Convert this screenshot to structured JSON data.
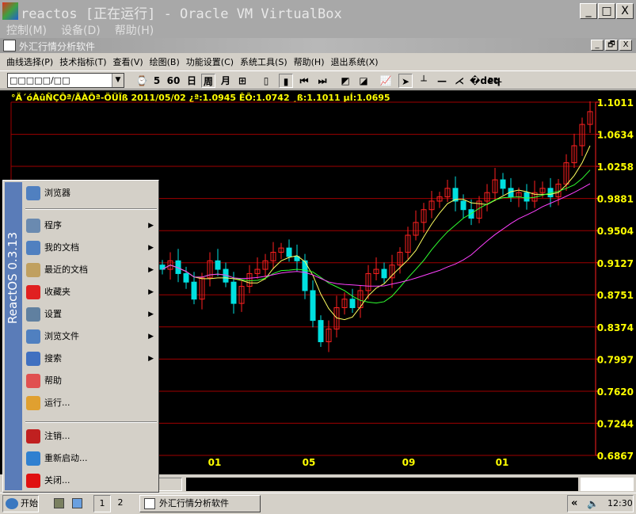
{
  "vbox": {
    "title": "reactos [正在运行] - Oracle VM VirtualBox",
    "menu": [
      "控制(M)",
      "设备(D)",
      "帮助(H)"
    ],
    "controls": [
      "_",
      "□",
      "X"
    ]
  },
  "app": {
    "title": "外汇行情分析软件",
    "controls": [
      "_",
      "🗗",
      "X"
    ],
    "menu": [
      "曲线选择(P)",
      "技术指标(T)",
      "查看(V)",
      "绘图(B)",
      "功能设置(C)",
      "系统工具(S)",
      "帮助(H)",
      "退出系统(X)"
    ],
    "toolbar": {
      "combo_value": "□□□□□/□□",
      "buttons": [
        "⌚",
        "5",
        "60",
        "日",
        "周",
        "月",
        "⊞",
        "▯",
        "▮",
        "⏮",
        "⏭",
        "◩",
        "◪",
        "📈",
        "➤",
        "┴",
        "—",
        "⋌",
        "�deq",
        "DEL"
      ]
    }
  },
  "chart_data": {
    "type": "candlestick",
    "header": "°Ä´óÀûÑÇÔª/ÃÀÔª-ÖÜÏß 2011/05/02 ¿ª:1.0945 ÊÕ:1.0742 ¸ß:1.1011 µÍ:1.0695",
    "ylim": [
      0.6867,
      1.1011
    ],
    "y_ticks": [
      "1.1011",
      "1.0634",
      "1.0258",
      "0.9881",
      "0.9504",
      "0.9127",
      "0.8751",
      "0.8374",
      "0.7997",
      "0.7620",
      "0.7244",
      "0.6867"
    ],
    "x_ticks": [
      "01",
      "05",
      "09",
      "01"
    ],
    "grid": true,
    "closes": [
      0.905,
      0.915,
      0.9,
      0.89,
      0.87,
      0.895,
      0.915,
      0.905,
      0.89,
      0.865,
      0.885,
      0.9,
      0.905,
      0.915,
      0.925,
      0.93,
      0.92,
      0.915,
      0.88,
      0.845,
      0.82,
      0.835,
      0.86,
      0.87,
      0.86,
      0.88,
      0.9,
      0.905,
      0.895,
      0.91,
      0.925,
      0.945,
      0.96,
      0.975,
      0.985,
      0.99,
      1.0,
      0.985,
      0.975,
      0.965,
      0.985,
      0.995,
      1.01,
      1.0,
      0.99,
      0.995,
      0.985,
      0.995,
      1.0,
      0.99,
      1.005,
      1.03,
      1.05,
      1.075,
      1.09
    ],
    "ma_periods": [
      5,
      10,
      20
    ],
    "colors": {
      "up": "#ff2020",
      "down": "#00e0e0",
      "ma5": "#ffff60",
      "ma10": "#30ff30",
      "ma20": "#ff40ff",
      "grid": "#a00000",
      "text": "#ffff00"
    }
  },
  "startmenu": {
    "brand": "ReactOS  0.3.13",
    "items": [
      {
        "label": "浏览器",
        "icon": "browser-icon",
        "sub": false
      },
      {
        "label": "程序",
        "icon": "programs-icon",
        "sub": true
      },
      {
        "label": "我的文档",
        "icon": "documents-icon",
        "sub": true
      },
      {
        "label": "最近的文档",
        "icon": "recent-icon",
        "sub": true
      },
      {
        "label": "收藏夹",
        "icon": "favorites-icon",
        "sub": true
      },
      {
        "label": "设置",
        "icon": "settings-icon",
        "sub": true
      },
      {
        "label": "浏览文件",
        "icon": "folder-icon",
        "sub": true
      },
      {
        "label": "搜索",
        "icon": "search-icon",
        "sub": true
      },
      {
        "label": "帮助",
        "icon": "help-icon",
        "sub": false
      },
      {
        "label": "运行...",
        "icon": "run-icon",
        "sub": false
      },
      {
        "label": "注销...",
        "icon": "logoff-icon",
        "sub": false
      },
      {
        "label": "重新启动...",
        "icon": "restart-icon",
        "sub": false
      },
      {
        "label": "关闭...",
        "icon": "shutdown-icon",
        "sub": false
      }
    ]
  },
  "taskbar": {
    "start": "开始",
    "desktops": [
      "1",
      "2"
    ],
    "task": "外汇行情分析软件",
    "tray_arrow": "«",
    "clock": "12:30"
  }
}
